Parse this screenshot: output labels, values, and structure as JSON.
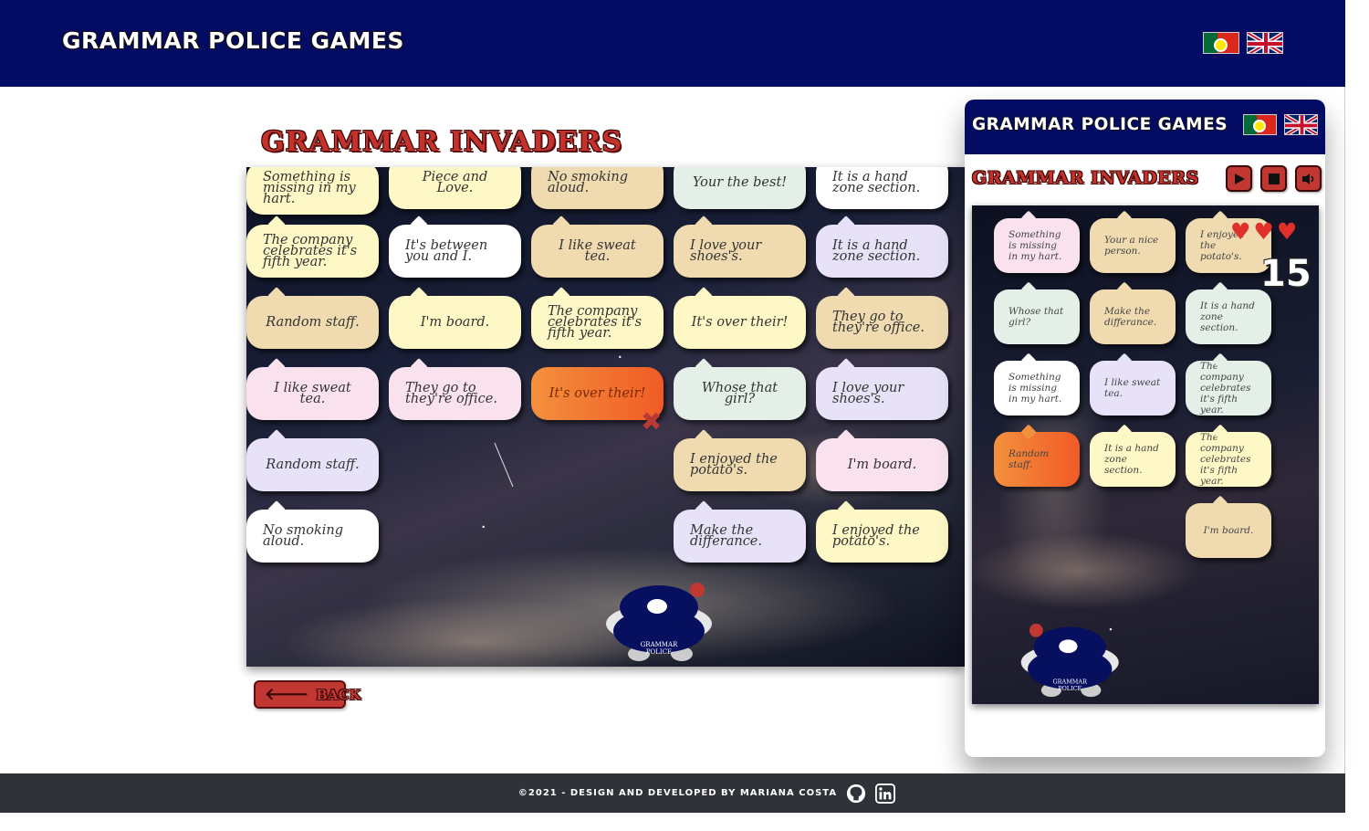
{
  "header": {
    "brand": "Grammar Police Games"
  },
  "game": {
    "title": "Grammar Invaders",
    "bubbles": [
      "Something is missing in my hart.",
      "Piece and Love.",
      "No smoking aloud.",
      "Your the best!",
      "It is a hand zone section.",
      "The company celebrates it's fifth year.",
      "It's between you and I.",
      "I like sweat tea.",
      "I love your shoes's.",
      "It is a hand zone section.",
      "Random staff.",
      "I'm board.",
      "The company celebrates it's fifth year.",
      "It's over their!",
      "They go to they're office.",
      "I like sweat tea.",
      "They go to they're office.",
      "It's over their!",
      "Whose that girl?",
      "I love your shoes's.",
      "Random staff.",
      "I enjoyed the potato's.",
      "I'm board.",
      "No smoking aloud.",
      "Make the differance.",
      "I enjoyed the potato's."
    ],
    "ship_label_1": "GRAMMAR",
    "ship_label_2": "POLICE",
    "back_label": "Back"
  },
  "mobile": {
    "brand": "Grammar Police Games",
    "title": "Grammar Invaders",
    "score": "15",
    "bubbles": [
      "Something is missing in my hart.",
      "Your a nice person.",
      "I enjoyed the potato's.",
      "Whose that girl?",
      "Make the differance.",
      "It is a hand zone section.",
      "Something is missing in my hart.",
      "I like sweat tea.",
      "The company celebrates it's fifth year.",
      "Random staff.",
      "It is a hand zone section.",
      "The company celebrates it's fifth year.",
      "I'm board."
    ]
  },
  "footer": {
    "text": "©2021 - Design and developed by Mariana Costa"
  },
  "colors": {
    "navy": "#030b62",
    "brand_red": "#c13832",
    "footer": "#2f3238"
  },
  "icons": [
    "portugal-flag-icon",
    "uk-flag-icon",
    "play-icon",
    "stop-icon",
    "sound-icon",
    "heart-icon",
    "github-icon",
    "linkedin-icon",
    "back-arrow-icon",
    "close-icon"
  ]
}
